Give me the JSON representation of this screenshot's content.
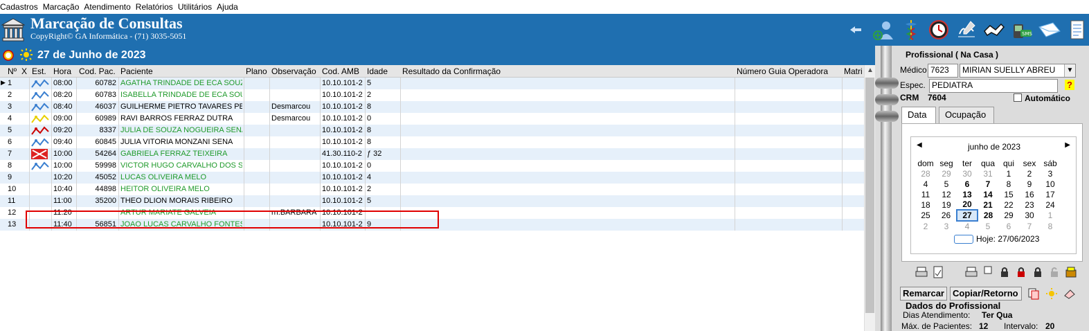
{
  "menu": [
    "Cadastros",
    "Marcação",
    "Atendimento",
    "Relatórios",
    "Utilitários",
    "Ajuda"
  ],
  "header": {
    "title": "Marcação de Consultas",
    "copyright": "CopyRight© GA Informática - (71) 3035-5051"
  },
  "date_bar": {
    "date": "27 de Junho de 2023"
  },
  "grid": {
    "columns": [
      "Nº",
      "X",
      "Est.",
      "Hora",
      "Cod. Pac.",
      "Paciente",
      "Plano",
      "Observação",
      "Cod. AMB",
      "Idade",
      "Resultado da Confirmação",
      "Número Guia Operadora",
      "Matri"
    ],
    "rows": [
      {
        "n": "1",
        "hora": "08:00",
        "cod": "60782",
        "paciente": "AGATHA TRINDADE DE ECA SOUZA",
        "plano": "",
        "obs": "",
        "amb": "10.10.101-2",
        "idade": "5",
        "color": "green"
      },
      {
        "n": "2",
        "hora": "08:20",
        "cod": "60783",
        "paciente": "ISABELLA TRINDADE DE ECA SOUZA",
        "plano": "",
        "obs": "",
        "amb": "10.10.101-2",
        "idade": "2",
        "color": "green"
      },
      {
        "n": "3",
        "hora": "08:40",
        "cod": "46037",
        "paciente": "GUILHERME PIETRO TAVARES PEREIRA",
        "plano": "",
        "obs": "Desmarcou",
        "amb": "10.10.101-2",
        "idade": "8",
        "color": "black"
      },
      {
        "n": "4",
        "hora": "09:00",
        "cod": "60989",
        "paciente": "RAVI BARROS FERRAZ DUTRA",
        "plano": "",
        "obs": "Desmarcou",
        "amb": "10.10.101-2",
        "idade": "0",
        "color": "black"
      },
      {
        "n": "5",
        "hora": "09:20",
        "cod": "8337",
        "paciente": "JULIA DE SOUZA NOGUEIRA SENA",
        "plano": "",
        "obs": "",
        "amb": "10.10.101-2",
        "idade": "8",
        "color": "green"
      },
      {
        "n": "6",
        "hora": "09:40",
        "cod": "60845",
        "paciente": "JULIA VITORIA MONZANI SENA",
        "plano": "",
        "obs": "",
        "amb": "10.10.101-2",
        "idade": "8",
        "color": "black"
      },
      {
        "n": "7",
        "hora": "10:00",
        "cod": "54264",
        "paciente": "GABRIELA FERRAZ TEIXEIRA",
        "plano": "",
        "obs": "",
        "amb": "41.30.110-2",
        "idade": "ƒ 32",
        "color": "green"
      },
      {
        "n": "8",
        "hora": "10:00",
        "cod": "59998",
        "paciente": "VICTOR HUGO CARVALHO DOS SANTOS",
        "plano": "",
        "obs": "",
        "amb": "10.10.101-2",
        "idade": "0",
        "color": "green"
      },
      {
        "n": "9",
        "hora": "10:20",
        "cod": "45052",
        "paciente": "LUCAS OLIVEIRA MELO",
        "plano": "",
        "obs": "",
        "amb": "10.10.101-2",
        "idade": "4",
        "color": "green"
      },
      {
        "n": "10",
        "hora": "10:40",
        "cod": "44898",
        "paciente": "HEITOR OLIVEIRA MELO",
        "plano": "",
        "obs": "",
        "amb": "10.10.101-2",
        "idade": "2",
        "color": "green"
      },
      {
        "n": "11",
        "hora": "11:00",
        "cod": "35200",
        "paciente": "THEO DLION MORAIS RIBEIRO",
        "plano": "",
        "obs": "",
        "amb": "10.10.101-2",
        "idade": "5",
        "color": "black"
      },
      {
        "n": "12",
        "hora": "11:20",
        "cod": "",
        "paciente": "ARTUR MARIATE GALVEIA",
        "plano": "",
        "obs": "rn:BARBARA",
        "amb": "10.10.101-2",
        "idade": "",
        "color": "green"
      },
      {
        "n": "13",
        "hora": "11:40",
        "cod": "56851",
        "paciente": "JOAO LUCAS CARVALHO FONTES",
        "plano": "",
        "obs": "",
        "amb": "10.10.101-2",
        "idade": "9",
        "color": "green"
      }
    ]
  },
  "profissional": {
    "group_title": "Profissional ( Na Casa )",
    "medico_label": "Médico",
    "medico_code": "7623",
    "medico_name": "MIRIAN SUELLY ABREU",
    "espec_label": "Espec.",
    "espec_value": "PEDIATRA",
    "crm_label": "CRM",
    "crm_value": "7604",
    "automatico_label": "Automático",
    "help": "?"
  },
  "tabs": [
    "Data",
    "Ocupação"
  ],
  "calendar": {
    "month_title": "junho de 2023",
    "weekdays": [
      "dom",
      "seg",
      "ter",
      "qua",
      "qui",
      "sex",
      "sáb"
    ],
    "weeks": [
      [
        "28",
        "29",
        "30",
        "31",
        "1",
        "2",
        "3"
      ],
      [
        "4",
        "5",
        "6",
        "7",
        "8",
        "9",
        "10"
      ],
      [
        "11",
        "12",
        "13",
        "14",
        "15",
        "16",
        "17"
      ],
      [
        "18",
        "19",
        "20",
        "21",
        "22",
        "23",
        "24"
      ],
      [
        "25",
        "26",
        "27",
        "28",
        "29",
        "30",
        "1"
      ],
      [
        "2",
        "3",
        "4",
        "5",
        "6",
        "7",
        "8"
      ]
    ],
    "today_label": "Hoje: 27/06/2023"
  },
  "buttons": {
    "remarcar": "Remarcar",
    "copiar": "Copiar/Retorno"
  },
  "dados": {
    "title": "Dados do Profissional",
    "dias_label": "Dias Atendimento:",
    "dias_value": "Ter Qua",
    "max_label": "Máx. de Pacientes:",
    "max_value": "12",
    "intervalo_label": "Intervalo:",
    "intervalo_value": "20"
  }
}
